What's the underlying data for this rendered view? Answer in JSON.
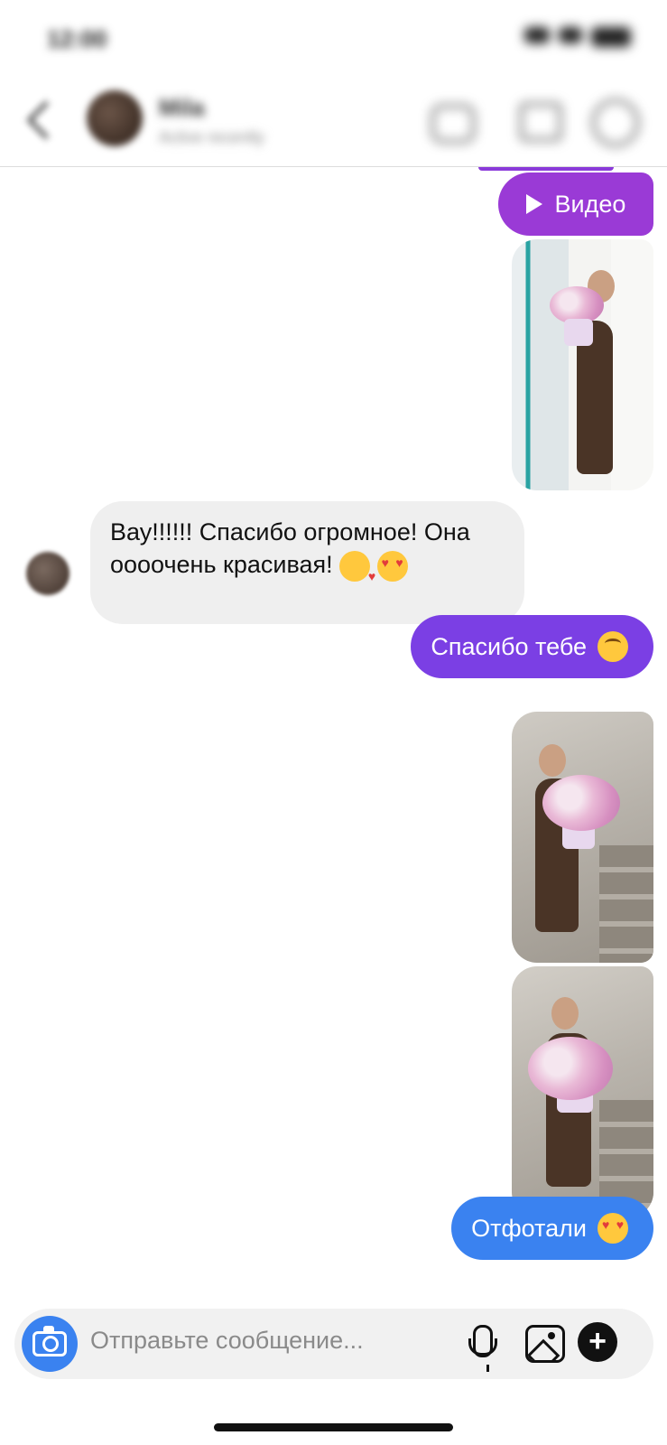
{
  "header": {
    "status_time": "12:00",
    "contact_name": "Mila",
    "contact_status": "Active recently"
  },
  "messages": {
    "video_label": "Видео",
    "incoming_text": "Вау!!!!!! Спасибо огромное! Она оооочень красивая!",
    "outgoing_thanks": "Спасибо тебе",
    "outgoing_photos": "Отфотали"
  },
  "composer": {
    "placeholder": "Отправьте сообщение..."
  },
  "colors": {
    "purple_bubble": "#7b3fe4",
    "video_bubble": "#9a3ad6",
    "blue_bubble": "#3a82f0",
    "incoming_bubble": "#efefef"
  },
  "icons": {
    "camera": "camera-icon",
    "mic": "microphone-icon",
    "gallery": "gallery-icon",
    "plus": "plus-icon",
    "play": "play-icon"
  }
}
